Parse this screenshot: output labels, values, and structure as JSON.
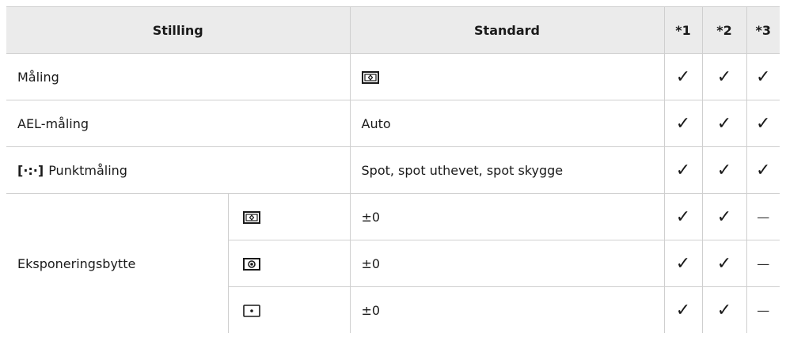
{
  "header": {
    "col_setting": "Stilling",
    "col_default": "Standard",
    "col_1": "*1",
    "col_2": "*2",
    "col_3": "*3"
  },
  "rows": [
    {
      "label": "Måling",
      "default_icon": "evaluative-metering-icon",
      "c1": "✓",
      "c2": "✓",
      "c3": "✓"
    },
    {
      "label": "AEL-måling",
      "default": "Auto",
      "c1": "✓",
      "c2": "✓",
      "c3": "✓"
    },
    {
      "label_icon": "spot-metering-bracket-icon",
      "label_icon_text": "[·:·]",
      "label": "Punktmåling",
      "default": "Spot, spot uthevet, spot skygge",
      "c1": "✓",
      "c2": "✓",
      "c3": "✓"
    }
  ],
  "exposure": {
    "label": "Eksponeringsbytte",
    "subrows": [
      {
        "mode_icon": "evaluative-metering-icon",
        "value": "±0",
        "c1": "✓",
        "c2": "✓",
        "c3": "—"
      },
      {
        "mode_icon": "center-weighted-metering-icon",
        "value": "±0",
        "c1": "✓",
        "c2": "✓",
        "c3": "—"
      },
      {
        "mode_icon": "spot-metering-icon",
        "value": "±0",
        "c1": "✓",
        "c2": "✓",
        "c3": "—"
      }
    ]
  }
}
